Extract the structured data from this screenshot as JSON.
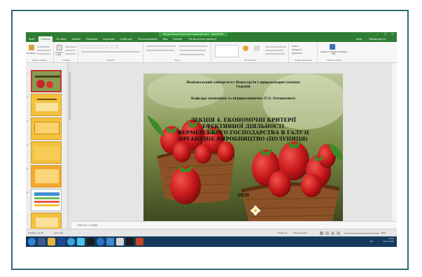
{
  "window": {
    "title": "Ms-ppt-Лекція-Економічні-критерії.pptx - PowerPoint",
    "controls": "— ❐ ✕"
  },
  "ribbon": {
    "tabs": [
      "Файл",
      "Главная",
      "Вставка",
      "Дизайн",
      "Переходы",
      "Анимация",
      "Слайд-шоу",
      "Рецензирование",
      "Вид",
      "Formato",
      "Что вы хотите сделать?"
    ],
    "active_tab": "Главная",
    "right_items": [
      "Вход",
      "Общий доступ"
    ],
    "groups": [
      "Буфер обмена",
      "Слайды",
      "Шрифт",
      "Абзац",
      "Рисование",
      "Редактирование",
      "Adobe Acrobat"
    ],
    "buttons": {
      "paste": "Вставить",
      "new_slide": "Создать слайд",
      "find": "Найти",
      "replace": "Заменить",
      "select": "Выделить",
      "create_pdf": "Создать и поделиться файлом PDF"
    }
  },
  "thumbnails": {
    "numbers": [
      "1",
      "2",
      "3",
      "4",
      "5",
      "6",
      "7"
    ],
    "selected_index": 0
  },
  "slide": {
    "header_line1": "Національний університет біоресурсів і природокористування",
    "header_line2": "України",
    "header_line3": "Кафедра економіки та підприємництва (Т.О. Олешкевич)",
    "title_line1": "ЛЕКЦІЯ 4. ЕКОНОМІЧНІ КРИТЕРІЇ",
    "title_line2": "ЕФЕКТИВНОЇ ДІЯЛЬНОСТІ",
    "title_line3": "ФЕРМЕРСЬКОГО ГОСПОДАРСТВА В ГАЛУЗІ",
    "title_line4": "ОРГАНІЧНЕ ВИРОБНИЦТВО (ПОЛУНИЦЯ)",
    "year": "2020"
  },
  "notes": {
    "placeholder": "Заметки к слайду"
  },
  "status_bar": {
    "slide_counter": "Слайд 1 из 30",
    "language": "русский",
    "notes_label": "Заметки",
    "comments_label": "Примечания",
    "zoom": "88%"
  },
  "taskbar": {
    "time": "13:04",
    "date": "19.11.2020",
    "lang": "RU"
  },
  "colors": {
    "accent": "#2f7d32",
    "thumb_gold": "#f4c13c",
    "taskbar": "#153a5e"
  }
}
